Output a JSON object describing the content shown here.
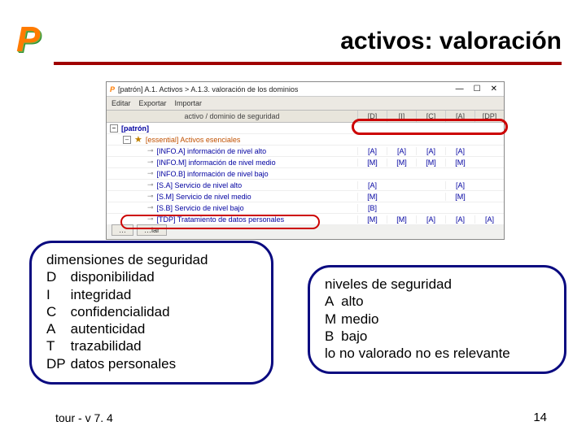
{
  "slide": {
    "title": "activos: valoración",
    "footer_left": "tour - v 7. 4",
    "page_number": "14"
  },
  "app": {
    "title": "[patrón] A.1. Activos > A.1.3. valoración de los dominios",
    "menu": {
      "editar": "Editar",
      "exportar": "Exportar",
      "importar": "Importar"
    },
    "columns": {
      "label": "activo / dominio de seguridad",
      "dims": [
        "[D]",
        "[I]",
        "[C]",
        "[A]",
        "[DP]"
      ]
    },
    "tree": {
      "root": "[patrón]",
      "category": "[essential] Activos esenciales",
      "rows": [
        {
          "label": "[INFO.A] información de nivel alto",
          "vals": [
            "[A]",
            "[A]",
            "[A]",
            "[A]",
            ""
          ]
        },
        {
          "label": "[INFO.M] información de nivel medio",
          "vals": [
            "[M]",
            "[M]",
            "[M]",
            "[M]",
            ""
          ]
        },
        {
          "label": "[INFO.B] información de nivel bajo",
          "vals": [
            "",
            "",
            "",
            "",
            ""
          ]
        },
        {
          "label": "[S.A] Servicio de nivel alto",
          "vals": [
            "[A]",
            "",
            "",
            "[A]",
            ""
          ]
        },
        {
          "label": "[S.M] Servicio de nivel medio",
          "vals": [
            "[M]",
            "",
            "",
            "[M]",
            ""
          ]
        },
        {
          "label": "[S.B] Servicio de nivel bajo",
          "vals": [
            "[B]",
            "",
            "",
            "",
            ""
          ]
        },
        {
          "label": "[TDP] Tratamiento de datos personales",
          "vals": [
            "[M]",
            "[M]",
            "[A]",
            "[A]",
            "[A]"
          ]
        }
      ]
    },
    "buttons": {
      "b1": "…",
      "b2": "…iar"
    }
  },
  "callouts": {
    "left": {
      "header": "dimensiones de seguridad",
      "items": [
        {
          "k": "D",
          "v": "disponibilidad"
        },
        {
          "k": "I",
          "v": "integridad"
        },
        {
          "k": "C",
          "v": "confidencialidad"
        },
        {
          "k": "A",
          "v": "autenticidad"
        },
        {
          "k": "T",
          "v": "trazabilidad"
        },
        {
          "k": "DP",
          "v": "datos personales"
        }
      ]
    },
    "right": {
      "header": "niveles de seguridad",
      "items": [
        {
          "k": "A",
          "v": "alto"
        },
        {
          "k": "M",
          "v": "medio"
        },
        {
          "k": "B",
          "v": "bajo"
        }
      ],
      "note": "lo no valorado no es relevante"
    }
  }
}
